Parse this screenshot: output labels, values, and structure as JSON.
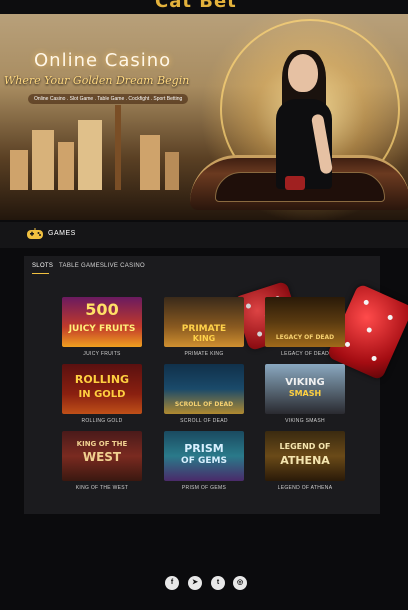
{
  "header": {
    "logo_fragment": "Cat Bet"
  },
  "hero": {
    "title": "Online Casino",
    "tagline": "Where Your Golden Dream Begin",
    "subline": "Online Casino . Slot Game . Table Game . Cockfight . Sport Betting"
  },
  "games_section": {
    "icon": "gamepad-icon",
    "label": "GAMES"
  },
  "tabs": [
    {
      "label": "SLOTS",
      "active": true
    },
    {
      "label": "TABLE GAMES",
      "active": false
    },
    {
      "label": "LIVE CASINO",
      "active": false
    }
  ],
  "games": [
    {
      "caption": "JUICY FRUITS",
      "art_line1": "500",
      "art_line2": "JUICY FRUITS"
    },
    {
      "caption": "PRIMATE KING",
      "art_line1": "PRIMATE",
      "art_line2": "KING"
    },
    {
      "caption": "LEGACY OF DEAD",
      "art_line1": "LEGACY OF DEAD",
      "art_line2": ""
    },
    {
      "caption": "ROLLING GOLD",
      "art_line1": "ROLLING",
      "art_line2": "IN GOLD"
    },
    {
      "caption": "SCROLL OF DEAD",
      "art_line1": "SCROLL OF DEAD",
      "art_line2": ""
    },
    {
      "caption": "VIKING SMASH",
      "art_line1": "VIKING",
      "art_line2": "SMASH"
    },
    {
      "caption": "KING OF THE WEST",
      "art_line1": "KING OF THE",
      "art_line2": "WEST"
    },
    {
      "caption": "PRISM OF GEMS",
      "art_line1": "PRISM",
      "art_line2": "OF GEMS"
    },
    {
      "caption": "LEGEND OF ATHENA",
      "art_line1": "LEGEND OF",
      "art_line2": "ATHENA"
    }
  ],
  "social": [
    {
      "icon": "facebook-icon",
      "glyph": "f"
    },
    {
      "icon": "telegram-icon",
      "glyph": "➤"
    },
    {
      "icon": "twitter-icon",
      "glyph": "t"
    },
    {
      "icon": "instagram-icon",
      "glyph": "◎"
    }
  ],
  "colors": {
    "accent": "#f0c040",
    "panel": "#1b1b1e",
    "background": "#0b0b0d"
  }
}
